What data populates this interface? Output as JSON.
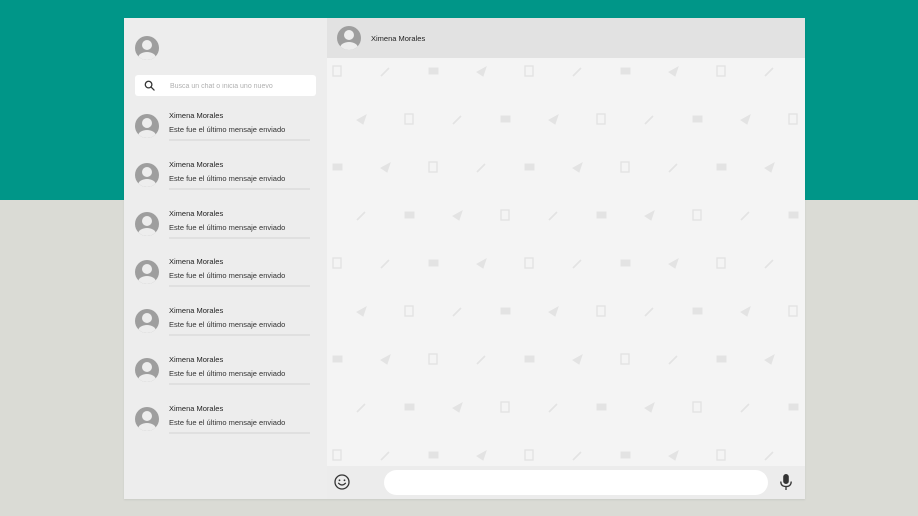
{
  "sidebar": {
    "search_placeholder": "Busca un chat o inicia uno nuevo",
    "chats": [
      {
        "name": "Ximena Morales",
        "preview": "Este fue el último mensaje enviado"
      },
      {
        "name": "Ximena Morales",
        "preview": "Este fue el último mensaje enviado"
      },
      {
        "name": "Ximena Morales",
        "preview": "Este fue el último mensaje enviado"
      },
      {
        "name": "Ximena Morales",
        "preview": "Este fue el último mensaje enviado"
      },
      {
        "name": "Ximena Morales",
        "preview": "Este fue el último mensaje enviado"
      },
      {
        "name": "Ximena Morales",
        "preview": "Este fue el último mensaje enviado"
      },
      {
        "name": "Ximena Morales",
        "preview": "Este fue el último mensaje enviado"
      }
    ]
  },
  "conversation": {
    "contact_name": "Ximena Morales",
    "message_value": ""
  },
  "icons": {
    "profile": "avatar-icon",
    "search": "search-icon",
    "emoji": "smiley-icon",
    "mic": "microphone-icon"
  },
  "colors": {
    "brand": "#009688",
    "backdrop": "#dadbd5",
    "sidebar_bg": "#ededed",
    "header_bg": "#e2e2e2",
    "chat_bg": "#f4f4f4",
    "avatar": "#9e9e9e"
  }
}
